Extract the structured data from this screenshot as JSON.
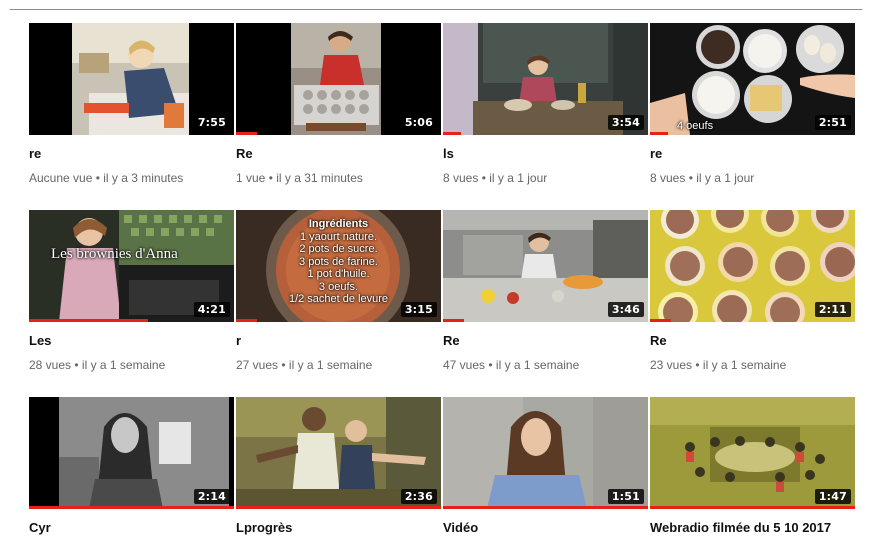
{
  "videos": [
    {
      "title": "re",
      "meta": "Aucune vue • il y a 3 minutes",
      "duration": "7:55",
      "progress": 0,
      "thumb_icon": "child-cooking-kitchen"
    },
    {
      "title": "Re",
      "meta": "1 vue • il y a 31 minutes",
      "duration": "5:06",
      "progress": 0.1,
      "thumb_icon": "boy-muffin-tray"
    },
    {
      "title": "ls",
      "meta": "8 vues • il y a 1 jour",
      "duration": "3:54",
      "progress": 0.09,
      "thumb_icon": "child-at-counter"
    },
    {
      "title": "re",
      "meta": "8 vues • il y a 1 jour",
      "duration": "2:51",
      "progress": 0.09,
      "thumb_icon": "ingredient-bowls",
      "overlay_caption": "4 oeufs"
    },
    {
      "title": "Les",
      "meta": "28 vues • il y a 1 semaine",
      "duration": "4:21",
      "progress": 0.58,
      "thumb_icon": "girl-oven",
      "overlay_caption": "Les brownies d'Anna"
    },
    {
      "title": "r",
      "meta": "27 vues • il y a 1 semaine",
      "duration": "3:15",
      "progress": 0.1,
      "thumb_icon": "recipe-bowl",
      "recipe_lines": [
        "Ingrédients",
        "1 yaourt nature.",
        "2 pots de sucre.",
        "3 pots de farine.",
        "1 pot d'huile.",
        "3 oeufs.",
        "1/2 sachet de levure"
      ]
    },
    {
      "title": "Re",
      "meta": "47 vues • il y a 1 semaine",
      "duration": "3:46",
      "progress": 0.1,
      "thumb_icon": "kitchen-counter"
    },
    {
      "title": "Re",
      "meta": "23 vues • il y a 1 semaine",
      "duration": "2:11",
      "progress": 0.1,
      "thumb_icon": "cupcake-liners"
    },
    {
      "title": "Cyr",
      "meta": "",
      "duration": "2:14",
      "progress": 1,
      "thumb_icon": "girl-portrait-bw"
    },
    {
      "title": "Lprogrès",
      "meta": "",
      "duration": "2:36",
      "progress": 1,
      "thumb_icon": "two-boys-dancing"
    },
    {
      "title": "Vidéo",
      "meta": "",
      "duration": "1:51",
      "progress": 1,
      "thumb_icon": "girl-talking"
    },
    {
      "title": "Webradio filmée du 5 10 2017",
      "meta": "",
      "duration": "1:47",
      "progress": 1,
      "thumb_icon": "classroom-overhead"
    }
  ],
  "colors": {
    "progress": "#e62117",
    "title": "#111111",
    "meta": "#666666",
    "duration_bg": "#000000"
  }
}
